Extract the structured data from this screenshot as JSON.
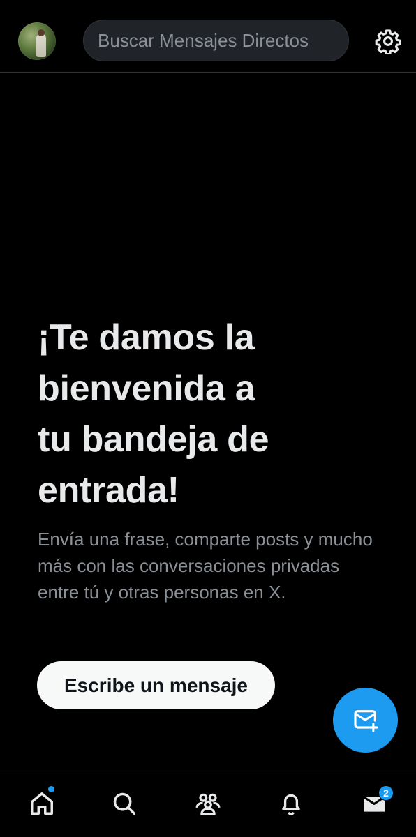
{
  "header": {
    "search_placeholder": "Buscar Mensajes Directos",
    "avatar_icon": "profile-avatar",
    "settings_icon": "gear-icon"
  },
  "welcome": {
    "title_lines": [
      "¡Te damos la",
      "bienvenida a",
      "tu bandeja de",
      "entrada!"
    ],
    "subtitle": "Envía una frase, comparte posts y mucho más con las conversaciones privadas entre tú y otras personas en X.",
    "compose_button_label": "Escribe un mensaje"
  },
  "fab": {
    "icon": "new-message-icon"
  },
  "bottom_nav": {
    "items": [
      {
        "name": "home",
        "icon": "home-icon",
        "has_dot": true
      },
      {
        "name": "search",
        "icon": "search-icon"
      },
      {
        "name": "communities",
        "icon": "people-icon"
      },
      {
        "name": "notifications",
        "icon": "bell-icon"
      },
      {
        "name": "messages",
        "icon": "mail-icon",
        "badge": "2"
      }
    ]
  },
  "colors": {
    "background": "#000000",
    "accent": "#1d9bf0",
    "text_primary": "#e7e9ea",
    "text_secondary": "#8b9096",
    "divider": "#2f3336"
  }
}
